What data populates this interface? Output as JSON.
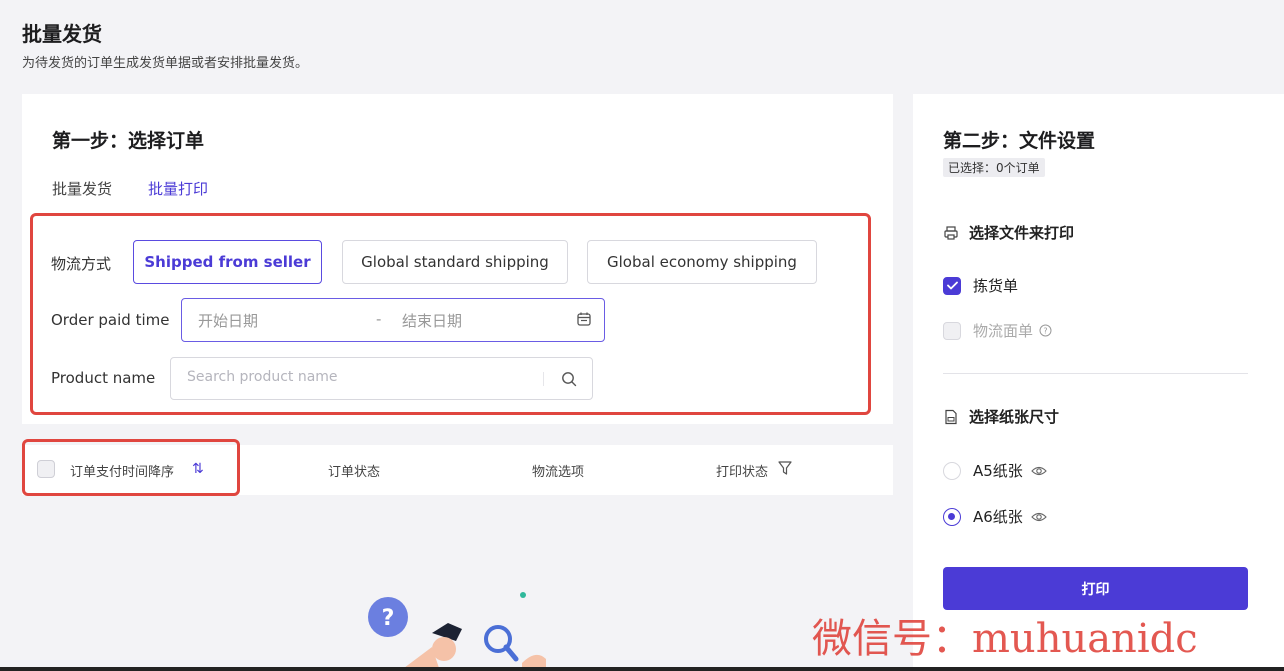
{
  "page": {
    "title": "批量发货",
    "subtitle": "为待发货的订单生成发货单据或者安排批量发货。"
  },
  "step1": {
    "title": "第一步：选择订单",
    "tabs": [
      {
        "label": "批量发货",
        "active": false
      },
      {
        "label": "批量打印",
        "active": true
      }
    ]
  },
  "filters": {
    "shipping_label": "物流方式",
    "shipping_options": [
      {
        "label": "Shipped from seller",
        "selected": true
      },
      {
        "label": "Global standard shipping",
        "selected": false
      },
      {
        "label": "Global economy shipping",
        "selected": false
      }
    ],
    "paid_time_label": "Order paid time",
    "date_start_placeholder": "开始日期",
    "date_separator": "-",
    "date_end_placeholder": "结束日期",
    "product_label": "Product name",
    "product_placeholder": "Search product name"
  },
  "table": {
    "columns": [
      {
        "label": "订单支付时间降序",
        "icon": "sort-icon"
      },
      {
        "label": "订单状态"
      },
      {
        "label": "物流选项"
      },
      {
        "label": "打印状态",
        "icon": "filter-icon"
      }
    ],
    "sort_glyph": "⇅"
  },
  "step2": {
    "title": "第二步：文件设置",
    "selected_badge": "已选择：0个订单",
    "print_section_title": "选择文件来打印",
    "documents": [
      {
        "label": "拣货单",
        "checked": true,
        "disabled": false
      },
      {
        "label": "物流面单",
        "checked": false,
        "disabled": true
      }
    ],
    "paper_section_title": "选择纸张尺寸",
    "paper_sizes": [
      {
        "label": "A5纸张",
        "selected": false
      },
      {
        "label": "A6纸张",
        "selected": true
      }
    ],
    "print_button": "打印"
  },
  "watermark": "微信号：muhuanidc",
  "colors": {
    "accent": "#4b3bd6",
    "highlight_box": "#e0463f",
    "background": "#f3f3f6"
  }
}
